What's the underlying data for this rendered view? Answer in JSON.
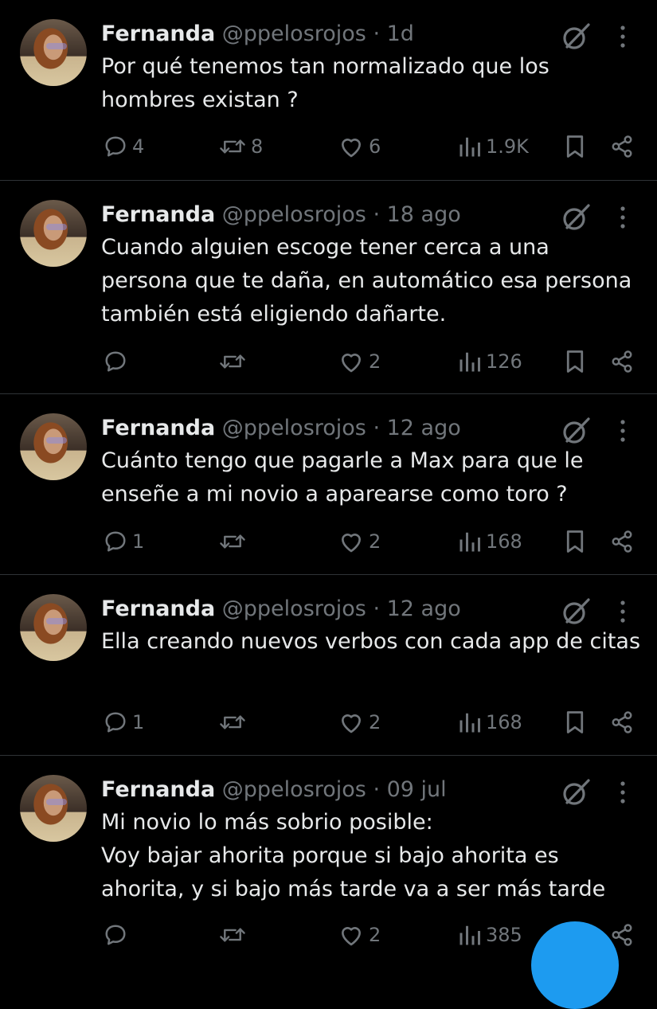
{
  "tweets": [
    {
      "name": "Fernanda",
      "meta": "@ppelosrojos · 1d",
      "text": "Por qué tenemos tan normalizado que los hombres existan ?",
      "replies": "4",
      "retweets": "8",
      "likes": "6",
      "views": "1.9K"
    },
    {
      "name": "Fernanda",
      "meta": "@ppelosrojos · 18 ago",
      "text": "Cuando alguien escoge tener cerca a una persona que te daña, en automático esa persona también está eligiendo dañarte.",
      "replies": "",
      "retweets": "",
      "likes": "2",
      "views": "126"
    },
    {
      "name": "Fernanda",
      "meta": "@ppelosrojos · 12 ago",
      "text": "Cuánto tengo que pagarle a Max para que le enseñe a mi novio a aparearse como toro ?",
      "replies": "1",
      "retweets": "",
      "likes": "2",
      "views": "168"
    },
    {
      "name": "Fernanda",
      "meta": "@ppelosrojos · 12 ago",
      "text": "Ella creando nuevos verbos con cada app de citas",
      "replies": "1",
      "retweets": "",
      "likes": "2",
      "views": "168"
    },
    {
      "name": "Fernanda",
      "meta": "@ppelosrojos · 09 jul",
      "text": "Mi novio lo más sobrio posible:\nVoy bajar ahorita porque si bajo ahorita es ahorita, y si bajo más tarde va a ser más tarde",
      "replies": "",
      "retweets": "",
      "likes": "2",
      "views": "385"
    }
  ],
  "colors": {
    "background": "#000000",
    "text": "#e7e9ea",
    "muted": "#71767b",
    "accent": "#1d9bf0",
    "divider": "#2f3336"
  },
  "icons": [
    "reply-icon",
    "retweet-icon",
    "like-icon",
    "views-icon",
    "bookmark-icon",
    "share-icon",
    "grok-icon",
    "more-icon"
  ]
}
